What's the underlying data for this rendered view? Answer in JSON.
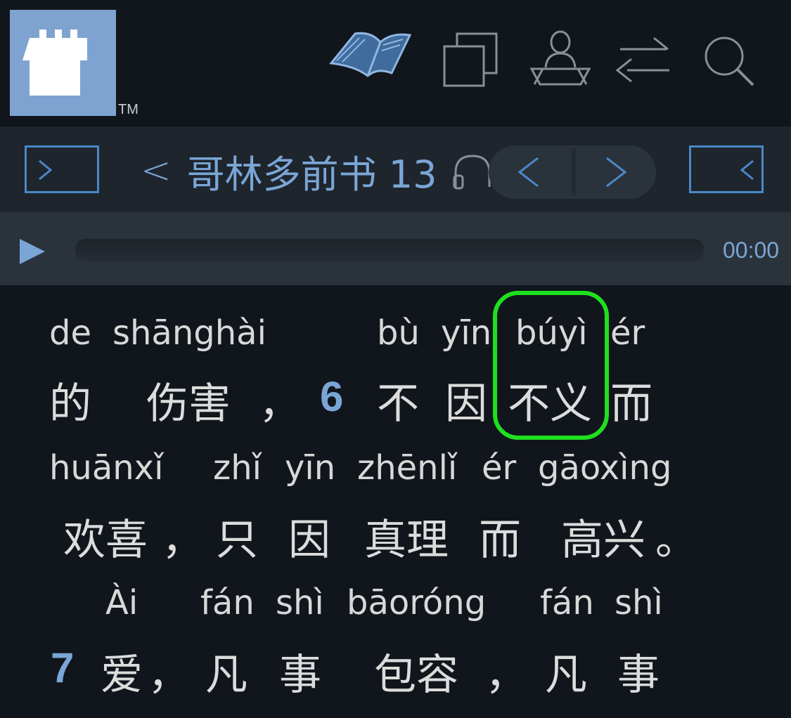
{
  "logo": {
    "trademark": "TM"
  },
  "toolbar": {
    "icons": [
      "book-icon",
      "windows-icon",
      "speaker-icon",
      "swap-icon",
      "search-icon"
    ]
  },
  "nav": {
    "chapter_title": "哥林多前书 13",
    "back_symbol": "<"
  },
  "audio": {
    "time": "00:00",
    "progress": 0
  },
  "passage": {
    "line1": {
      "pinyin": [
        "de",
        "shānghài",
        "bù",
        "yīn",
        "búyì",
        "ér"
      ],
      "hanzi": [
        "的",
        "伤害",
        "，",
        "不",
        "因",
        "不义",
        "而"
      ],
      "verse": "6"
    },
    "line2": {
      "pinyin": [
        "huānxǐ",
        "zhǐ",
        "yīn",
        "zhēnlǐ",
        "ér",
        "gāoxìng"
      ],
      "hanzi": [
        "欢喜",
        "，",
        "只",
        "因",
        "真理",
        "而",
        "高兴",
        "。"
      ]
    },
    "line3": {
      "pinyin": [
        "Ài",
        "fán",
        "shì",
        "bāoróng",
        "fán",
        "shì"
      ],
      "hanzi": [
        "爱",
        "，",
        "凡",
        "事",
        "包容",
        "，",
        "凡",
        "事"
      ],
      "verse": "7"
    }
  },
  "colors": {
    "accent": "#7aa6d6",
    "highlight": "#1fe01f",
    "background": "#11161c"
  }
}
